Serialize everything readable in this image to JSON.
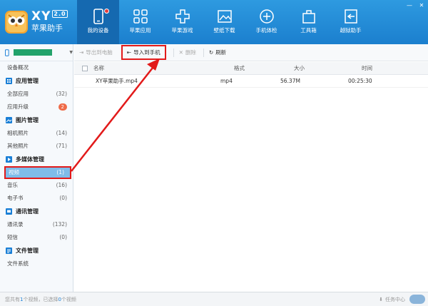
{
  "app": {
    "brand_xy": "XY",
    "brand_version": "2.0",
    "brand_name": "苹果助手",
    "window_controls": [
      "—",
      "✕"
    ]
  },
  "nav": {
    "items": [
      {
        "label": "我的设备",
        "icon": "phone-icon"
      },
      {
        "label": "苹果应用",
        "icon": "apps-grid-icon"
      },
      {
        "label": "苹果游戏",
        "icon": "gamepad-icon"
      },
      {
        "label": "壁纸下载",
        "icon": "picture-icon"
      },
      {
        "label": "手机体检",
        "icon": "health-plus-icon"
      },
      {
        "label": "工具箱",
        "icon": "toolbox-icon"
      },
      {
        "label": "越狱助手",
        "icon": "exit-icon"
      }
    ]
  },
  "sidebar": {
    "overview": "设备概况",
    "apps_head": "应用管理",
    "apps": [
      {
        "label": "全部应用",
        "count": "(32)"
      },
      {
        "label": "应用升级",
        "count": "2"
      }
    ],
    "photos_head": "图片管理",
    "photos": [
      {
        "label": "相机照片",
        "count": "(14)"
      },
      {
        "label": "其他照片",
        "count": "(71)"
      }
    ],
    "media_head": "多媒体管理",
    "media": [
      {
        "label": "视频",
        "count": "(1)"
      },
      {
        "label": "音乐",
        "count": "(16)"
      },
      {
        "label": "电子书",
        "count": "(0)"
      }
    ],
    "comm_head": "通讯管理",
    "comm": [
      {
        "label": "通讯录",
        "count": "(132)"
      },
      {
        "label": "短信",
        "count": "(0)"
      }
    ],
    "files_head": "文件管理",
    "files": [
      {
        "label": "文件系统"
      }
    ]
  },
  "toolbar": {
    "export": "导出到电脑",
    "import": "导入到手机",
    "delete": "删除",
    "refresh": "刷新"
  },
  "table": {
    "headers": [
      "名称",
      "格式",
      "大小",
      "时间"
    ],
    "rows": [
      {
        "name": "XY苹果助手.mp4",
        "format": "mp4",
        "size": "56.37M",
        "time": "00:25:30"
      }
    ]
  },
  "status": {
    "p1": "您共有",
    "total": "1",
    "p2": "个视频，已选择",
    "selected": "0",
    "p3": "个视频",
    "task_center": "任务中心"
  },
  "colors": {
    "header": "#1b7fce",
    "highlight": "#e21a1a",
    "selected_item": "#7fbce9",
    "device_name": "#23a36b",
    "badge": "#ee6a48"
  }
}
